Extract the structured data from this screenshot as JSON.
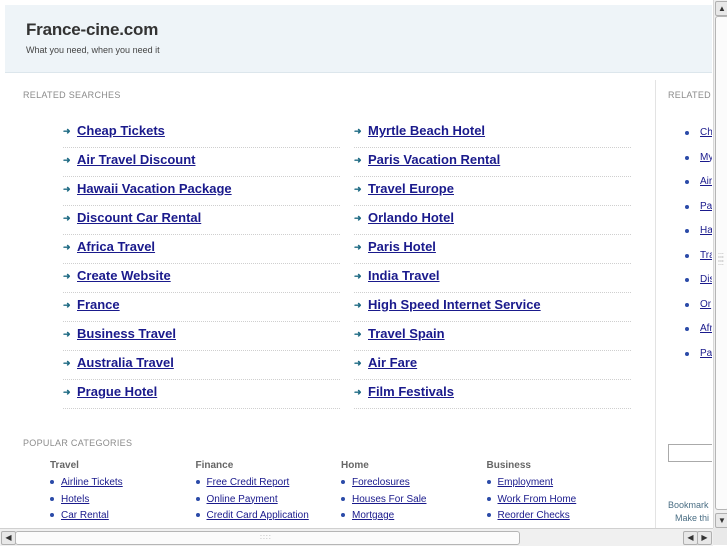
{
  "header": {
    "title": "France-cine.com",
    "tagline": "What you need, when you need it"
  },
  "related_searches": {
    "title": "RELATED SEARCHES",
    "left": [
      "Cheap Tickets",
      "Air Travel Discount",
      "Hawaii Vacation Package",
      "Discount Car Rental",
      "Africa Travel",
      "Create Website",
      "France",
      "Business Travel",
      "Australia Travel",
      "Prague Hotel"
    ],
    "right": [
      "Myrtle Beach Hotel",
      "Paris Vacation Rental",
      "Travel Europe",
      "Orlando Hotel",
      "Paris Hotel",
      "India Travel",
      "High Speed Internet Service",
      "Travel Spain",
      "Air Fare",
      "Film Festivals"
    ]
  },
  "popular_categories": {
    "title": "POPULAR CATEGORIES",
    "columns": [
      {
        "heading": "Travel",
        "links": [
          "Airline Tickets",
          "Hotels",
          "Car Rental"
        ]
      },
      {
        "heading": "Finance",
        "links": [
          "Free Credit Report",
          "Online Payment",
          "Credit Card Application"
        ]
      },
      {
        "heading": "Home",
        "links": [
          "Foreclosures",
          "Houses For Sale",
          "Mortgage"
        ]
      },
      {
        "heading": "Business",
        "links": [
          "Employment",
          "Work From Home",
          "Reorder Checks"
        ]
      }
    ]
  },
  "right_sidebar": {
    "title": "RELATED",
    "items": [
      "Ch",
      "My",
      "Air",
      "Pa",
      "Ha",
      "Tra",
      "Dis",
      "Or",
      "Afr",
      "Pa"
    ],
    "bookmark_text": "Bookmark",
    "make_text": "Make thi"
  },
  "scrollbars": {
    "up_arrow": "▲",
    "down_arrow": "▼",
    "left_arrow": "◀",
    "right_arrow": "▶"
  },
  "icons": {
    "bullet_arrow": "arrow-right-icon",
    "bullet_dot": "dot-icon"
  },
  "colors": {
    "link": "#1a1a8c",
    "header_bg": "#eef4f8",
    "arrow": "#1f6b84"
  }
}
